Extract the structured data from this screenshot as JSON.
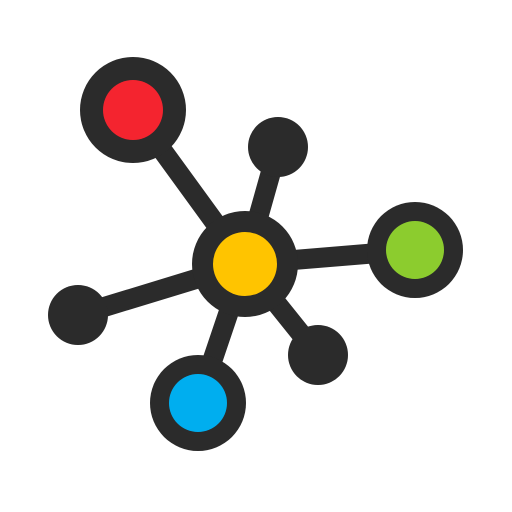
{
  "logo": {
    "icon": "network-graph-icon",
    "colors": {
      "background": "#ffffff",
      "outline": "#2b2b2b",
      "hub": "#ffc400",
      "red_node": "#f4242f",
      "green_node": "#8ccc2e",
      "blue_node": "#00aeef"
    }
  }
}
